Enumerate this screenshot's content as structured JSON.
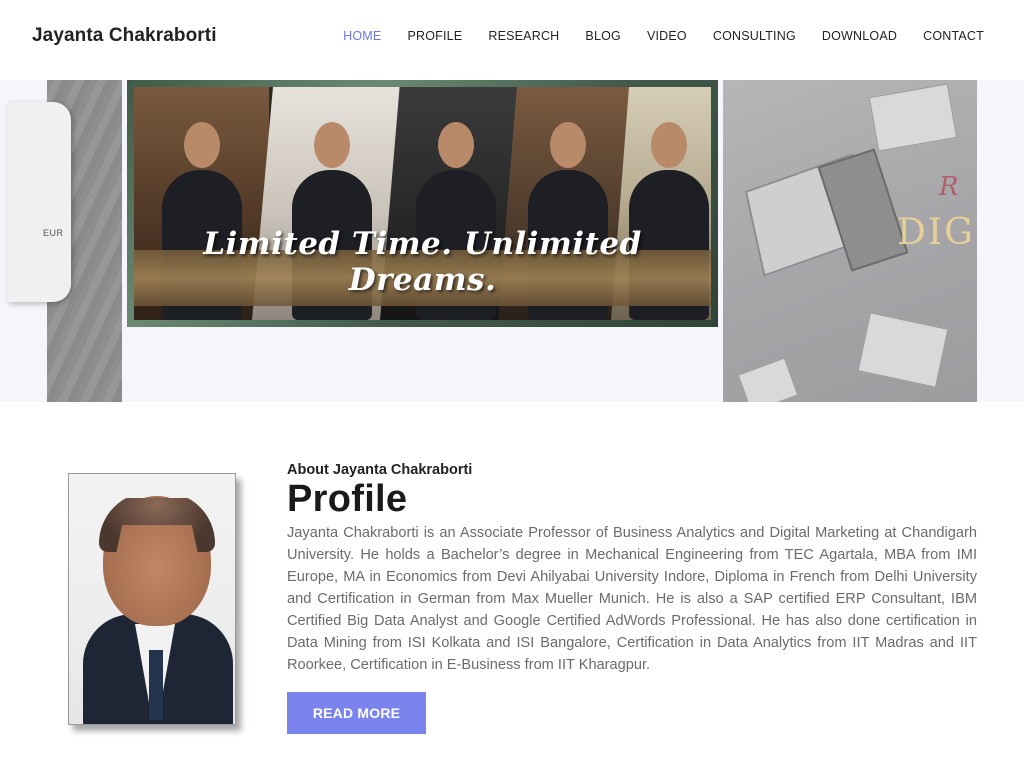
{
  "header": {
    "brand": "Jayanta Chakraborti",
    "nav": [
      {
        "label": "HOME",
        "active": true
      },
      {
        "label": "PROFILE",
        "active": false
      },
      {
        "label": "RESEARCH",
        "active": false
      },
      {
        "label": "BLOG",
        "active": false
      },
      {
        "label": "VIDEO",
        "active": false
      },
      {
        "label": "CONSULTING",
        "active": false
      },
      {
        "label": "DOWNLOAD",
        "active": false
      },
      {
        "label": "CONTACT",
        "active": false
      }
    ]
  },
  "slider": {
    "left_partial_text": "EUR",
    "main_banner_text": "Limited Time. Unlimited Dreams.",
    "right_script_text": "R",
    "right_title_text": "DIGIT"
  },
  "profile": {
    "eyebrow": "About Jayanta Chakraborti",
    "title": "Profile",
    "body": "Jayanta Chakraborti is an Associate Professor of Business Analytics and Digital Marketing at Chandigarh University. He holds a Bachelor’s degree in Mechanical Engineering from TEC Agartala, MBA from IMI Europe, MA in Economics from Devi Ahilyabai University Indore, Diploma in French from Delhi University and Certification in German from Max Mueller Munich. He is also a SAP certified ERP Consultant, IBM Certified Big Data Analyst and Google Certified AdWords Professional. He has also done certification in Data Mining from ISI Kolkata and ISI Bangalore, Certification in Data Analytics from IIT Madras and IIT Roorkee, Certification in E-Business from IIT Kharagpur.",
    "button_label": "READ MORE"
  },
  "colors": {
    "accent": "#7b84ed",
    "nav_active": "#6c7ae0",
    "slider_bg": "#f6f5fb"
  }
}
